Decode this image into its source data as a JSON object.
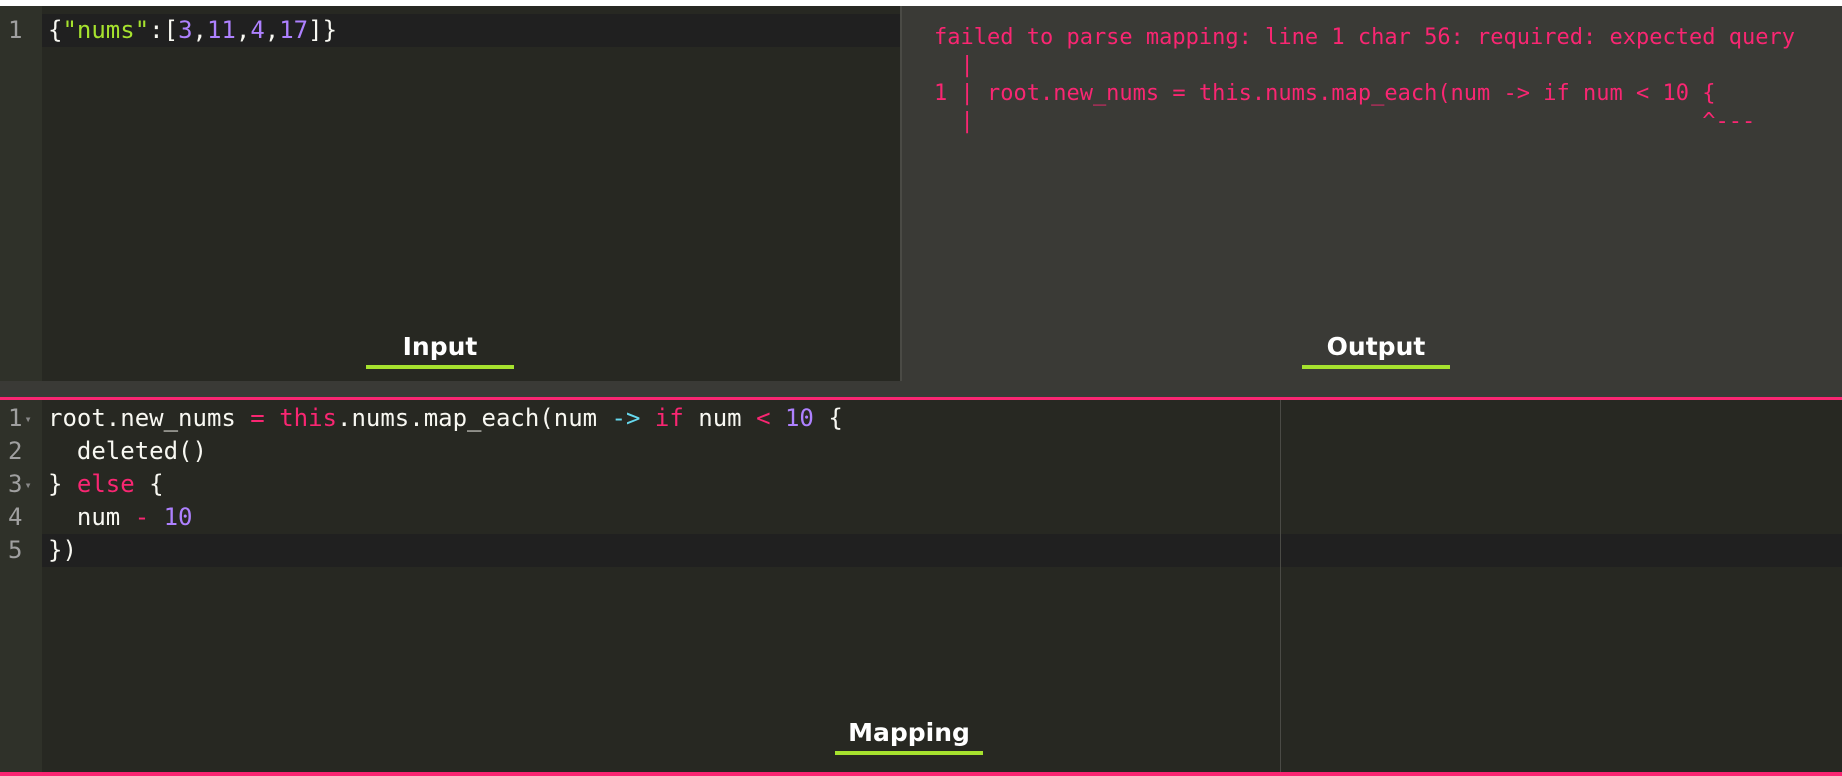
{
  "input": {
    "label": "Input",
    "line_numbers": [
      "1"
    ],
    "tokens": {
      "brace_open": "{",
      "key": "\"nums\"",
      "colon_bracket": ":[",
      "v1": "3",
      "c1": ",",
      "v2": "11",
      "c2": ",",
      "v3": "4",
      "c3": ",",
      "v4": "17",
      "close": "]}"
    }
  },
  "output": {
    "label": "Output",
    "error_lines": [
      "failed to parse mapping: line 1 char 56: required: expected query",
      "  |",
      "1 | root.new_nums = this.nums.map_each(num -> if num < 10 {",
      "  |                                                       ^---"
    ]
  },
  "mapping": {
    "label": "Mapping",
    "line_numbers": [
      "1",
      "2",
      "3",
      "4",
      "5"
    ],
    "l1": {
      "a": "root.new_nums ",
      "eq": "=",
      "b": " ",
      "this": "this",
      "c": ".nums.map_each(num ",
      "arrow": "->",
      "d": " ",
      "if": "if",
      "e": " num ",
      "lt": "<",
      "f": " ",
      "ten": "10",
      "g": " {"
    },
    "l2": "  deleted()",
    "l3": {
      "a": "} ",
      "else": "else",
      "b": " {"
    },
    "l4": {
      "a": "  num ",
      "minus": "-",
      "b": " ",
      "ten": "10"
    },
    "l5": "})"
  },
  "colors": {
    "error": "#f92672",
    "label_underline": "#a6e22e",
    "editor_bg": "#272822"
  }
}
